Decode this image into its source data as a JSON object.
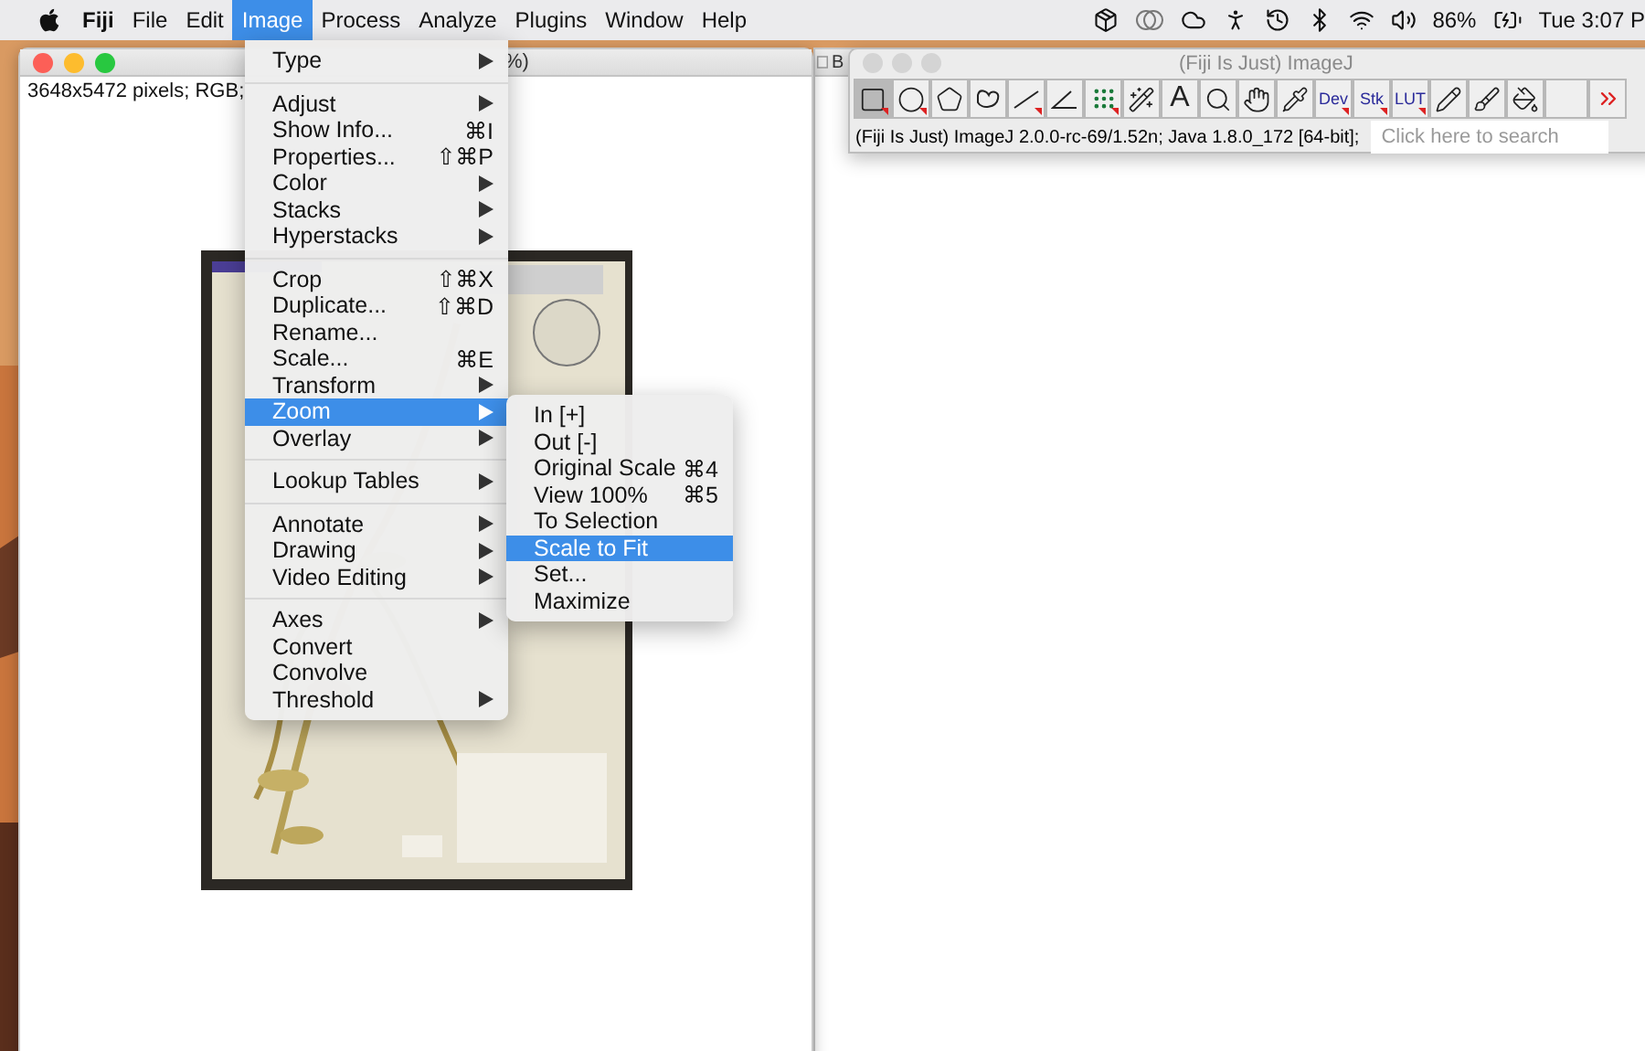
{
  "menu_bar": {
    "items": [
      {
        "label": "Fiji",
        "kind": "app",
        "selected": false
      },
      {
        "label": "File",
        "kind": "menu",
        "selected": false
      },
      {
        "label": "Edit",
        "kind": "menu",
        "selected": false
      },
      {
        "label": "Image",
        "kind": "menu",
        "selected": true
      },
      {
        "label": "Process",
        "kind": "menu",
        "selected": false
      },
      {
        "label": "Analyze",
        "kind": "menu",
        "selected": false
      },
      {
        "label": "Plugins",
        "kind": "menu",
        "selected": false
      },
      {
        "label": "Window",
        "kind": "menu",
        "selected": false
      },
      {
        "label": "Help",
        "kind": "menu",
        "selected": false
      }
    ],
    "battery": "86%",
    "clock": "Tue 3:07 P"
  },
  "image_menu": {
    "sections": [
      [
        {
          "label": "Type",
          "submenu": true,
          "selected": false
        }
      ],
      [
        {
          "label": "Adjust",
          "submenu": true,
          "selected": false
        },
        {
          "label": "Show Info...",
          "shortcut": "⌘I",
          "submenu": false,
          "selected": false
        },
        {
          "label": "Properties...",
          "shortcut": "⇧⌘P",
          "submenu": false,
          "selected": false
        },
        {
          "label": "Color",
          "submenu": true,
          "selected": false
        },
        {
          "label": "Stacks",
          "submenu": true,
          "selected": false
        },
        {
          "label": "Hyperstacks",
          "submenu": true,
          "selected": false
        }
      ],
      [
        {
          "label": "Crop",
          "shortcut": "⇧⌘X",
          "submenu": false,
          "selected": false
        },
        {
          "label": "Duplicate...",
          "shortcut": "⇧⌘D",
          "submenu": false,
          "selected": false
        },
        {
          "label": "Rename...",
          "submenu": false,
          "selected": false
        },
        {
          "label": "Scale...",
          "shortcut": "⌘E",
          "submenu": false,
          "selected": false
        },
        {
          "label": "Transform",
          "submenu": true,
          "selected": false
        },
        {
          "label": "Zoom",
          "submenu": true,
          "selected": true
        },
        {
          "label": "Overlay",
          "submenu": true,
          "selected": false
        }
      ],
      [
        {
          "label": "Lookup Tables",
          "submenu": true,
          "selected": false
        }
      ],
      [
        {
          "label": "Annotate",
          "submenu": true,
          "selected": false
        },
        {
          "label": "Drawing",
          "submenu": true,
          "selected": false
        },
        {
          "label": "Video Editing",
          "submenu": true,
          "selected": false
        }
      ],
      [
        {
          "label": "Axes",
          "submenu": true,
          "selected": false
        },
        {
          "label": "Convert",
          "submenu": false,
          "selected": false
        },
        {
          "label": "Convolve",
          "submenu": false,
          "selected": false
        },
        {
          "label": "Threshold",
          "submenu": true,
          "selected": false
        }
      ]
    ]
  },
  "zoom_submenu": {
    "items": [
      {
        "label": "In [+]",
        "selected": false
      },
      {
        "label": "Out [-]",
        "selected": false
      },
      {
        "label": "Original Scale",
        "shortcut": "⌘4",
        "selected": false
      },
      {
        "label": "View 100%",
        "shortcut": "⌘5",
        "selected": false
      },
      {
        "label": "To Selection",
        "selected": false
      },
      {
        "label": "Scale to Fit",
        "selected": true
      },
      {
        "label": "Set...",
        "selected": false
      },
      {
        "label": "Maximize",
        "selected": false
      }
    ]
  },
  "image_window": {
    "title": "%)",
    "info": "3648x5472 pixels; RGB;"
  },
  "back_window": {
    "title": "B"
  },
  "imagej_window": {
    "title": "(Fiji Is Just) ImageJ",
    "tools": [
      {
        "kind": "rectangle",
        "selected": true,
        "has_menu": true
      },
      {
        "kind": "oval",
        "selected": false,
        "has_menu": true
      },
      {
        "kind": "polygon",
        "selected": false,
        "has_menu": false
      },
      {
        "kind": "freehand",
        "selected": false,
        "has_menu": false
      },
      {
        "kind": "line",
        "selected": false,
        "has_menu": true
      },
      {
        "kind": "angle",
        "selected": false,
        "has_menu": false
      },
      {
        "kind": "points",
        "selected": false,
        "has_menu": true
      },
      {
        "kind": "wand",
        "selected": false,
        "has_menu": false
      },
      {
        "kind": "label",
        "label": "A",
        "selected": false,
        "has_menu": false
      },
      {
        "kind": "magnifier",
        "selected": false,
        "has_menu": false
      },
      {
        "kind": "hand",
        "selected": false,
        "has_menu": false
      },
      {
        "kind": "dropper",
        "selected": false,
        "has_menu": false
      },
      {
        "kind": "small_label",
        "label": "Dev",
        "selected": false,
        "has_menu": true
      },
      {
        "kind": "small_label",
        "label": "Stk",
        "selected": false,
        "has_menu": true
      },
      {
        "kind": "small_label",
        "label": "LUT",
        "selected": false,
        "has_menu": true
      },
      {
        "kind": "pencil",
        "selected": false,
        "has_menu": false
      },
      {
        "kind": "brush",
        "selected": false,
        "has_menu": false
      },
      {
        "kind": "bucket",
        "selected": false,
        "has_menu": false
      },
      {
        "kind": "blank",
        "selected": false,
        "has_menu": false
      },
      {
        "kind": "more",
        "selected": false,
        "has_menu": false
      }
    ],
    "status": "(Fiji Is Just) ImageJ 2.0.0-rc-69/1.52n; Java 1.8.0_172 [64-bit];",
    "search": {
      "placeholder": "Click here to search"
    }
  }
}
